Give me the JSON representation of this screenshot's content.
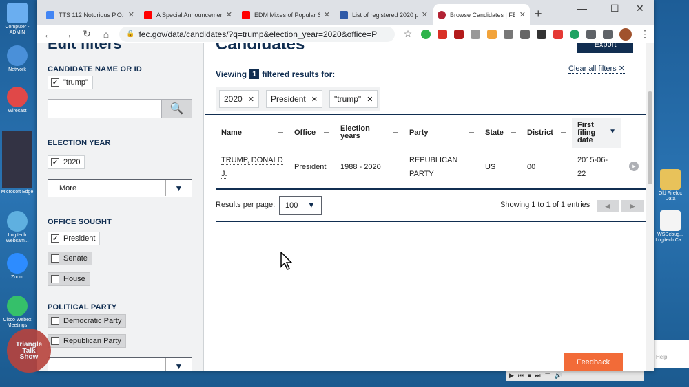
{
  "desktop": {
    "icons": [
      {
        "label": "Computer - ADMIN",
        "color": "#6aaef0"
      },
      {
        "label": "Network",
        "color": "#4a90d9"
      },
      {
        "label": "Wirecast",
        "color": "#e04848"
      },
      {
        "label": "Microsoft Edge",
        "color": "#334"
      },
      {
        "label": "Logitech Webcam...",
        "color": "#5fb0e0"
      },
      {
        "label": "Zoom",
        "color": "#2d8cff"
      },
      {
        "label": "Cisco Webex Meetings",
        "color": "#35c06a"
      }
    ],
    "right_icons": [
      {
        "label": "Old Firefox Data"
      },
      {
        "label": "WSDebug... Logitech Ca..."
      }
    ],
    "help": "Help"
  },
  "browser": {
    "tabs": [
      {
        "title": "TTS 112 Notorious P.O.D.",
        "color": "#4285f4"
      },
      {
        "title": "A Special Announcement",
        "color": "#ff0000"
      },
      {
        "title": "EDM Mixes of Popular So",
        "color": "#ff0000"
      },
      {
        "title": "List of registered 2020 p",
        "color": "#2f5aa8"
      },
      {
        "title": "Browse Candidates | FEC",
        "color": "#b22234"
      }
    ],
    "url": "fec.gov/data/candidates/?q=trump&election_year=2020&office=P"
  },
  "sidebar": {
    "title": "Edit filters",
    "candidate_label": "CANDIDATE NAME OR ID",
    "candidate_chip": "\"trump\"",
    "election_year_label": "ELECTION YEAR",
    "year_chip": "2020",
    "more_label": "More",
    "office_label": "OFFICE SOUGHT",
    "offices": [
      {
        "label": "President",
        "checked": true
      },
      {
        "label": "Senate",
        "checked": false
      },
      {
        "label": "House",
        "checked": false
      }
    ],
    "party_label": "POLITICAL PARTY",
    "parties": [
      {
        "label": "Democratic Party",
        "checked": false
      },
      {
        "label": "Republican Party",
        "checked": false
      }
    ]
  },
  "main": {
    "title": "Candidates",
    "export_label": "Export",
    "viewing_prefix": "Viewing",
    "viewing_count": "1",
    "viewing_suffix": "filtered results for:",
    "clear_all": "Clear all filters",
    "tags": [
      "2020",
      "President",
      "\"trump\""
    ],
    "columns": [
      {
        "label": "Name"
      },
      {
        "label": "Office"
      },
      {
        "label": "Election years"
      },
      {
        "label": "Party"
      },
      {
        "label": "State"
      },
      {
        "label": "District"
      },
      {
        "label": "First filing date"
      }
    ],
    "row": {
      "name": "TRUMP, DONALD J.",
      "office": "President",
      "election_years": "1988 - 2020",
      "party": "REPUBLICAN PARTY",
      "state": "US",
      "district": "00",
      "first_filing_date": "2015-06-22"
    },
    "results_per_page_label": "Results per page:",
    "results_per_page": "100",
    "showing": "Showing 1 to 1 of 1 entries",
    "feedback": "Feedback"
  },
  "watermark": {
    "line1": "Triangle",
    "line2": "Talk",
    "line3": "Show"
  }
}
